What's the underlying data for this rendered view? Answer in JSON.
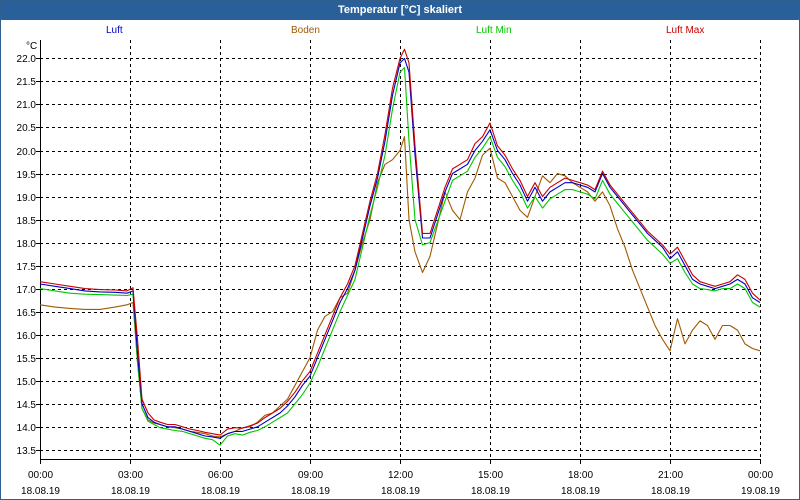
{
  "window": {
    "title": "Temperatur [°C] skaliert"
  },
  "chart_data": {
    "type": "line",
    "title": "Temperatur [°C] skaliert",
    "ylabel": "°C",
    "xlabel": "",
    "ylim": [
      13.3,
      22.4
    ],
    "yticks": [
      13.5,
      14.0,
      14.5,
      15.0,
      15.5,
      16.0,
      16.5,
      17.0,
      17.5,
      18.0,
      18.5,
      19.0,
      19.5,
      20.0,
      20.5,
      21.0,
      21.5,
      22.0
    ],
    "xticks": [
      {
        "time": "00:00",
        "date": "18.08.19"
      },
      {
        "time": "03:00",
        "date": "18.08.19"
      },
      {
        "time": "06:00",
        "date": "18.08.19"
      },
      {
        "time": "09:00",
        "date": "18.08.19"
      },
      {
        "time": "12:00",
        "date": "18.08.19"
      },
      {
        "time": "15:00",
        "date": "18.08.19"
      },
      {
        "time": "18:00",
        "date": "18.08.19"
      },
      {
        "time": "21:00",
        "date": "18.08.19"
      },
      {
        "time": "00:00",
        "date": "19.08.19"
      }
    ],
    "grid": true,
    "legend_position": "top",
    "x_hours": [
      0,
      0.5,
      1,
      1.5,
      2,
      2.5,
      2.9,
      3.1,
      3.25,
      3.4,
      3.6,
      3.8,
      4,
      4.25,
      4.5,
      4.75,
      5,
      5.25,
      5.5,
      5.75,
      6,
      6.25,
      6.5,
      6.75,
      7,
      7.25,
      7.5,
      7.75,
      8,
      8.25,
      8.5,
      8.75,
      9,
      9.25,
      9.5,
      9.75,
      10,
      10.25,
      10.5,
      10.75,
      11,
      11.25,
      11.5,
      11.75,
      12,
      12.15,
      12.3,
      12.5,
      12.75,
      13,
      13.25,
      13.5,
      13.75,
      14,
      14.25,
      14.5,
      14.75,
      15,
      15.25,
      15.5,
      15.75,
      16,
      16.25,
      16.5,
      16.75,
      17,
      17.25,
      17.5,
      17.75,
      18,
      18.25,
      18.5,
      18.75,
      19,
      19.25,
      19.5,
      19.75,
      20,
      20.25,
      20.5,
      20.75,
      21,
      21.25,
      21.5,
      21.75,
      22,
      22.25,
      22.5,
      22.75,
      23,
      23.25,
      23.5,
      23.75,
      24
    ],
    "series": [
      {
        "name": "Luft",
        "color": "#0000c8",
        "values": [
          17.1,
          17.05,
          17.0,
          16.95,
          16.93,
          16.92,
          16.9,
          16.95,
          15.6,
          14.5,
          14.2,
          14.1,
          14.05,
          14.0,
          14.0,
          13.95,
          13.9,
          13.85,
          13.8,
          13.78,
          13.75,
          13.85,
          13.9,
          13.9,
          13.95,
          14.0,
          14.1,
          14.2,
          14.3,
          14.45,
          14.65,
          14.9,
          15.1,
          15.5,
          15.9,
          16.3,
          16.7,
          17.0,
          17.4,
          18.1,
          18.8,
          19.4,
          20.2,
          21.2,
          21.9,
          22.0,
          21.7,
          19.9,
          18.1,
          18.1,
          18.6,
          19.1,
          19.5,
          19.6,
          19.7,
          20.0,
          20.2,
          20.45,
          20.0,
          19.8,
          19.5,
          19.25,
          18.9,
          19.2,
          18.9,
          19.1,
          19.2,
          19.3,
          19.3,
          19.25,
          19.2,
          19.1,
          19.5,
          19.2,
          19.0,
          18.8,
          18.6,
          18.4,
          18.2,
          18.05,
          17.9,
          17.65,
          17.8,
          17.5,
          17.2,
          17.1,
          17.05,
          17.0,
          17.05,
          17.1,
          17.2,
          17.1,
          16.8,
          16.7
        ]
      },
      {
        "name": "Boden",
        "color": "#a05a00",
        "values": [
          16.65,
          16.6,
          16.57,
          16.55,
          16.55,
          16.6,
          16.65,
          16.7,
          15.4,
          14.4,
          14.15,
          14.08,
          14.05,
          14.0,
          13.98,
          13.95,
          13.9,
          13.88,
          13.85,
          13.8,
          13.78,
          13.85,
          13.9,
          13.98,
          14.0,
          14.1,
          14.25,
          14.3,
          14.45,
          14.6,
          14.9,
          15.2,
          15.5,
          16.1,
          16.4,
          16.5,
          16.8,
          16.9,
          17.4,
          18.0,
          18.5,
          19.3,
          19.7,
          19.8,
          20.0,
          20.3,
          18.5,
          17.8,
          17.35,
          17.7,
          18.4,
          19.1,
          18.7,
          18.5,
          19.1,
          19.4,
          19.9,
          20.05,
          19.4,
          19.3,
          19.0,
          18.7,
          18.55,
          19.0,
          19.45,
          19.3,
          19.5,
          19.45,
          19.3,
          19.2,
          19.1,
          18.9,
          19.1,
          18.8,
          18.3,
          17.9,
          17.4,
          17.0,
          16.6,
          16.2,
          15.9,
          15.65,
          16.35,
          15.8,
          16.1,
          16.3,
          16.2,
          15.9,
          16.2,
          16.2,
          16.1,
          15.8,
          15.7,
          15.65
        ]
      },
      {
        "name": "Luft Min",
        "color": "#00c800",
        "values": [
          17.0,
          16.95,
          16.9,
          16.88,
          16.87,
          16.86,
          16.85,
          16.88,
          15.4,
          14.4,
          14.12,
          14.05,
          13.98,
          13.95,
          13.92,
          13.9,
          13.85,
          13.8,
          13.75,
          13.72,
          13.6,
          13.8,
          13.85,
          13.82,
          13.88,
          13.92,
          14.0,
          14.1,
          14.2,
          14.3,
          14.5,
          14.7,
          14.95,
          15.3,
          15.7,
          16.1,
          16.5,
          16.85,
          17.2,
          17.9,
          18.6,
          19.2,
          19.9,
          20.9,
          21.7,
          21.8,
          20.2,
          18.5,
          17.95,
          18.0,
          18.45,
          18.9,
          19.35,
          19.45,
          19.55,
          19.85,
          20.05,
          20.3,
          19.85,
          19.65,
          19.35,
          19.1,
          18.75,
          19.0,
          18.75,
          18.95,
          19.05,
          19.15,
          19.15,
          19.1,
          19.05,
          18.95,
          19.35,
          19.05,
          18.85,
          18.65,
          18.45,
          18.25,
          18.05,
          17.9,
          17.75,
          17.55,
          17.65,
          17.35,
          17.1,
          17.0,
          16.98,
          16.95,
          17.0,
          17.0,
          17.1,
          17.0,
          16.7,
          16.6
        ]
      },
      {
        "name": "Luft Max",
        "color": "#c80000",
        "values": [
          17.15,
          17.1,
          17.05,
          17.0,
          16.98,
          16.97,
          16.95,
          17.02,
          15.9,
          14.6,
          14.3,
          14.15,
          14.1,
          14.05,
          14.05,
          14.0,
          13.95,
          13.92,
          13.88,
          13.85,
          13.82,
          13.95,
          13.98,
          13.97,
          14.02,
          14.08,
          14.2,
          14.3,
          14.4,
          14.55,
          14.75,
          15.0,
          15.2,
          15.6,
          16.0,
          16.4,
          16.8,
          17.1,
          17.5,
          18.2,
          18.9,
          19.5,
          20.35,
          21.35,
          22.0,
          22.2,
          21.9,
          20.1,
          18.2,
          18.2,
          18.7,
          19.2,
          19.6,
          19.7,
          19.8,
          20.15,
          20.3,
          20.6,
          20.1,
          19.9,
          19.6,
          19.35,
          19.0,
          19.3,
          19.0,
          19.2,
          19.3,
          19.4,
          19.35,
          19.3,
          19.25,
          19.15,
          19.55,
          19.25,
          19.05,
          18.85,
          18.65,
          18.45,
          18.25,
          18.1,
          17.95,
          17.75,
          17.9,
          17.6,
          17.3,
          17.15,
          17.1,
          17.05,
          17.1,
          17.15,
          17.3,
          17.2,
          16.9,
          16.75
        ]
      }
    ]
  }
}
